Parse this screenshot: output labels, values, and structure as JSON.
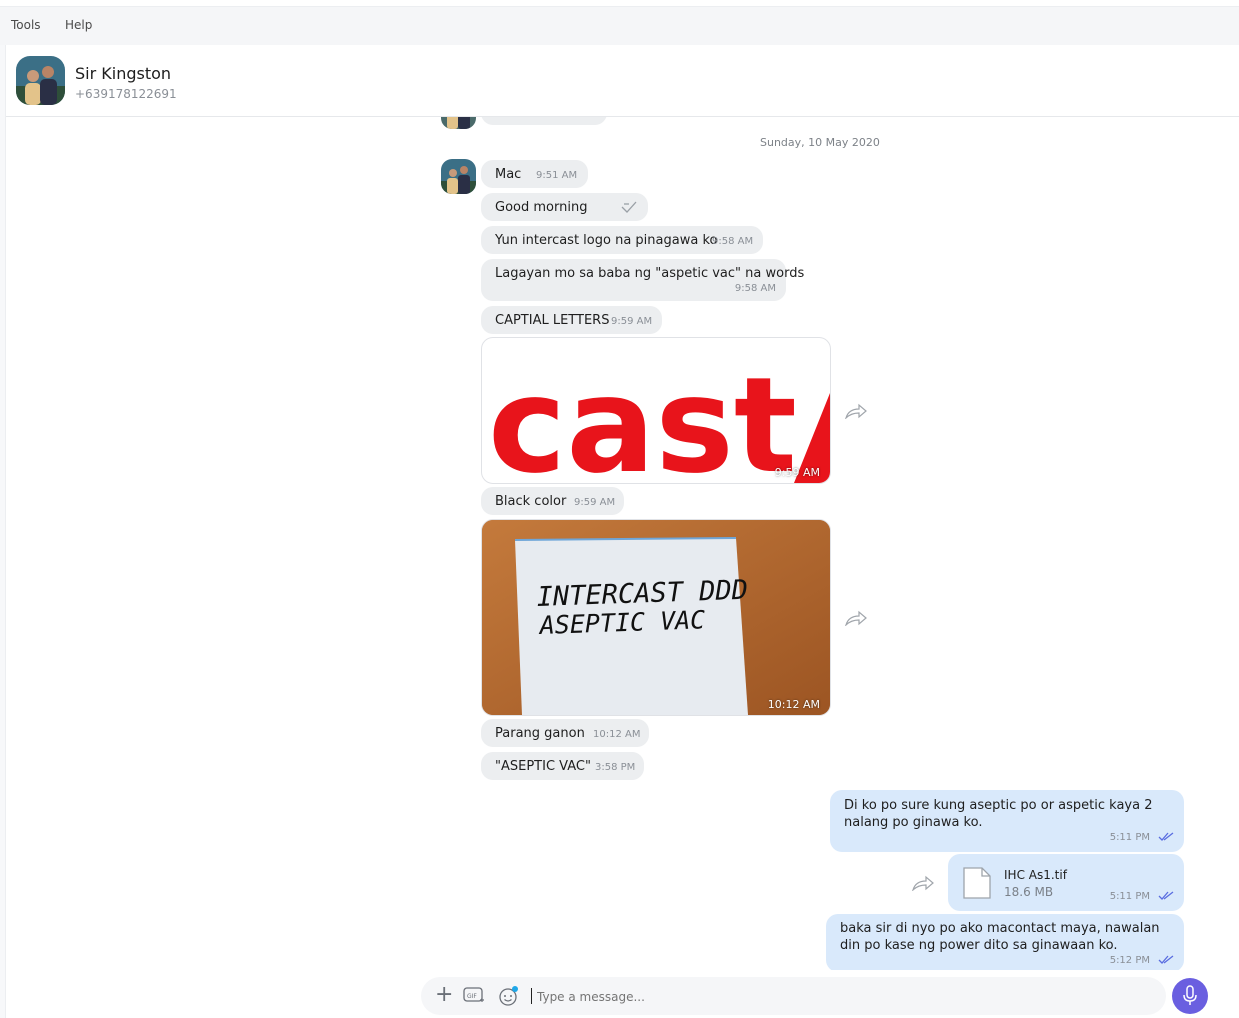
{
  "menu": {
    "tools": "Tools",
    "help": "Help"
  },
  "contact": {
    "name": "Sir Kingston",
    "phone": "+639178122691"
  },
  "date_separator": "Sunday, 10 May 2020",
  "incoming": [
    {
      "text": "Mac",
      "time": "9:51 AM"
    },
    {
      "text": "Good morning"
    },
    {
      "text": "Yun intercast logo na pinagawa ko",
      "time": "9:58 AM"
    },
    {
      "text": "Lagayan mo sa baba ng \"aspetic vac\" na words",
      "time": "9:58 AM"
    },
    {
      "text": "CAPTIAL LETTERS",
      "time": "9:59 AM"
    },
    {
      "text": "Black color",
      "time": "9:59 AM"
    },
    {
      "text": "Parang ganon",
      "time": "10:12 AM"
    },
    {
      "text": "\"ASEPTIC VAC\"",
      "time": "3:58 PM"
    }
  ],
  "images": [
    {
      "caption": "cast",
      "time": "9:59 AM"
    },
    {
      "line1": "INTERCAST DDD",
      "line2": "ASEPTIC VAC",
      "time": "10:12 AM"
    }
  ],
  "outgoing": [
    {
      "text": "Di ko po sure kung aseptic po or aspetic kaya 2 nalang po ginawa ko.",
      "time": "5:11 PM"
    },
    {
      "text": "baka sir di nyo po ako macontact maya, nawalan din po kase ng power dito sa ginawaan ko.",
      "time": "5:12 PM"
    }
  ],
  "file": {
    "name": "IHC As1.tif",
    "size": "18.6 MB",
    "time": "5:11 PM"
  },
  "composer": {
    "placeholder": "Type a message..."
  },
  "icons": {
    "forward": "forward-arrow-icon",
    "file": "document-icon",
    "plus": "plus-icon",
    "gif": "gif-icon",
    "emoji": "emoji-icon",
    "mic": "microphone-icon",
    "reaction": "reaction-icon"
  },
  "colors": {
    "accent": "#6a5fe0",
    "outgoing_bubble": "#d9e9fb",
    "incoming_bubble": "#eceef0"
  }
}
